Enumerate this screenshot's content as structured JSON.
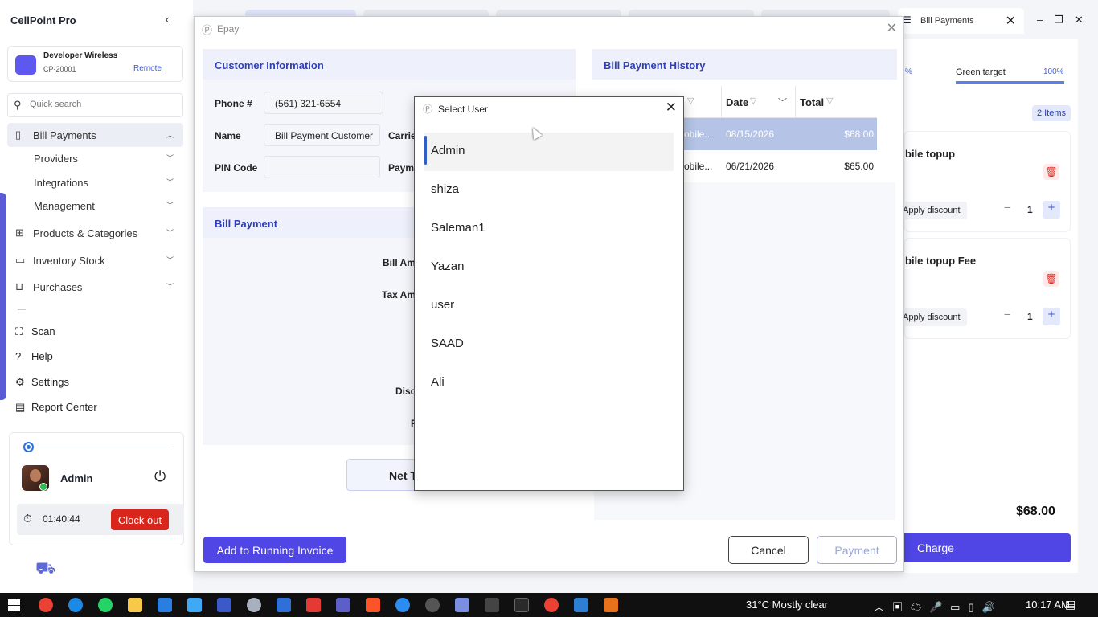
{
  "app": {
    "title": "CellPoint Pro"
  },
  "store": {
    "name": "Developer Wireless",
    "id": "CP-20001",
    "mode": "Remote"
  },
  "search": {
    "placeholder": "Quick search"
  },
  "nav": {
    "bill_payments": "Bill Payments",
    "providers": "Providers",
    "integrations": "Integrations",
    "management": "Management",
    "products": "Products & Categories",
    "inventory": "Inventory Stock",
    "purchases": "Purchases",
    "scan": "Scan",
    "help": "Help",
    "settings": "Settings",
    "report_center": "Report Center"
  },
  "user": {
    "name": "Admin",
    "timer": "01:40:44",
    "clock_out": "Clock out"
  },
  "top_tab": {
    "label": "Bill Payments"
  },
  "cart": {
    "target_pct_left": "%",
    "target_label": "Green target",
    "target_pct": "100%",
    "items_badge": "2 Items",
    "items": [
      {
        "name": "bile topup",
        "discount_label": "Apply discount",
        "qty": "1"
      },
      {
        "name": "bile topup Fee",
        "discount_label": "Apply discount",
        "qty": "1"
      }
    ],
    "total": "$68.00",
    "charge_label": "Charge"
  },
  "epay": {
    "title": "Epay",
    "customer_section": "Customer Information",
    "phone_label": "Phone #",
    "phone_value": "(561) 321-6554",
    "name_label": "Name",
    "name_value": "Bill Payment Customer",
    "carrier_label": "Carrie",
    "pin_label": "PIN Code",
    "pin_value": "",
    "payment_label": "Payme",
    "bill_section": "Bill Payment",
    "bill_amount_label": "Bill Am",
    "tax_amount_label": "Tax Am",
    "discount_label": "Disc",
    "p_label": "P",
    "net_total_label": "Net T",
    "history_section": "Bill Payment History",
    "history_columns": {
      "date": "Date",
      "total": "Total"
    },
    "history_rows": [
      {
        "desc": "obile...",
        "date": "08/15/2026",
        "total": "$68.00"
      },
      {
        "desc": "obile...",
        "date": "06/21/2026",
        "total": "$65.00"
      }
    ],
    "add_running_label": "Add to Running Invoice",
    "cancel_label": "Cancel",
    "payment_btn_label": "Payment"
  },
  "select_user": {
    "title": "Select User",
    "users": [
      "Admin",
      "shiza",
      "Saleman1",
      "Yazan",
      "user",
      "SAAD",
      "Ali"
    ]
  },
  "taskbar": {
    "weather": "31°C  Mostly clear",
    "time": "10:17 AM"
  },
  "colors": {
    "accent": "#4f46e5",
    "danger": "#d9261c",
    "header_text": "#2e3fb8"
  }
}
